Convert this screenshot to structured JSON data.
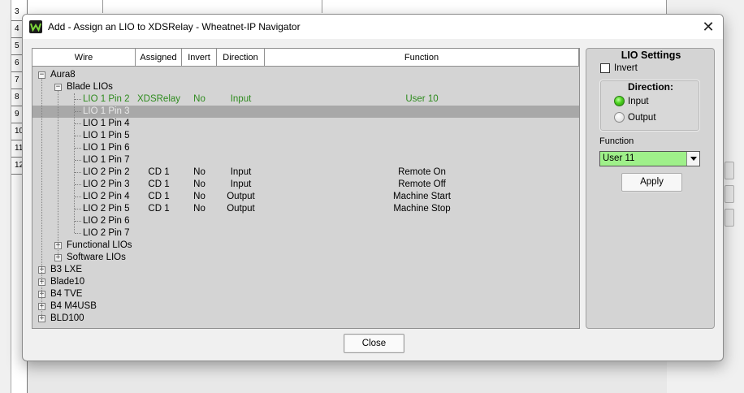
{
  "background": {
    "row_numbers": [
      "3",
      "4",
      "5",
      "6",
      "7",
      "8",
      "9",
      "10",
      "11",
      "12"
    ]
  },
  "dialog": {
    "title": "Add - Assign an LIO to XDSRelay - Wheatnet-IP Navigator",
    "close_icon_glyph": "✕",
    "close_button_label": "Close"
  },
  "tree": {
    "columns": [
      "Wire",
      "Assigned",
      "Invert",
      "Direction",
      "Function"
    ],
    "rows": [
      {
        "level": 0,
        "expander": "−",
        "wire": "Aura8",
        "assigned": "",
        "invert": "",
        "direction": "",
        "function": "",
        "state": "normal"
      },
      {
        "level": 1,
        "expander": "−",
        "wire": "Blade LIOs",
        "assigned": "",
        "invert": "",
        "direction": "",
        "function": "",
        "state": "normal"
      },
      {
        "level": 2,
        "expander": "",
        "wire": "LIO 1 Pin 2",
        "assigned": "XDSRelay",
        "invert": "No",
        "direction": "Input",
        "function": "User 10",
        "state": "green"
      },
      {
        "level": 2,
        "expander": "",
        "wire": "LIO 1 Pin 3",
        "assigned": "",
        "invert": "",
        "direction": "",
        "function": "",
        "state": "selected"
      },
      {
        "level": 2,
        "expander": "",
        "wire": "LIO 1 Pin 4",
        "assigned": "",
        "invert": "",
        "direction": "",
        "function": "",
        "state": "normal"
      },
      {
        "level": 2,
        "expander": "",
        "wire": "LIO 1 Pin 5",
        "assigned": "",
        "invert": "",
        "direction": "",
        "function": "",
        "state": "normal"
      },
      {
        "level": 2,
        "expander": "",
        "wire": "LIO 1 Pin 6",
        "assigned": "",
        "invert": "",
        "direction": "",
        "function": "",
        "state": "normal"
      },
      {
        "level": 2,
        "expander": "",
        "wire": "LIO 1 Pin 7",
        "assigned": "",
        "invert": "",
        "direction": "",
        "function": "",
        "state": "normal"
      },
      {
        "level": 2,
        "expander": "",
        "wire": "LIO 2 Pin 2",
        "assigned": "CD 1",
        "invert": "No",
        "direction": "Input",
        "function": "Remote On",
        "state": "normal"
      },
      {
        "level": 2,
        "expander": "",
        "wire": "LIO 2 Pin 3",
        "assigned": "CD 1",
        "invert": "No",
        "direction": "Input",
        "function": "Remote Off",
        "state": "normal"
      },
      {
        "level": 2,
        "expander": "",
        "wire": "LIO 2 Pin 4",
        "assigned": "CD 1",
        "invert": "No",
        "direction": "Output",
        "function": "Machine Start",
        "state": "normal"
      },
      {
        "level": 2,
        "expander": "",
        "wire": "LIO 2 Pin 5",
        "assigned": "CD 1",
        "invert": "No",
        "direction": "Output",
        "function": "Machine Stop",
        "state": "normal"
      },
      {
        "level": 2,
        "expander": "",
        "wire": "LIO 2 Pin 6",
        "assigned": "",
        "invert": "",
        "direction": "",
        "function": "",
        "state": "normal"
      },
      {
        "level": 2,
        "expander": "",
        "wire": "LIO 2 Pin 7",
        "assigned": "",
        "invert": "",
        "direction": "",
        "function": "",
        "state": "normal"
      },
      {
        "level": 1,
        "expander": "+",
        "wire": "Functional LIOs",
        "assigned": "",
        "invert": "",
        "direction": "",
        "function": "",
        "state": "normal"
      },
      {
        "level": 1,
        "expander": "+",
        "wire": "Software LIOs",
        "assigned": "",
        "invert": "",
        "direction": "",
        "function": "",
        "state": "normal"
      },
      {
        "level": 0,
        "expander": "+",
        "wire": "B3 LXE",
        "assigned": "",
        "invert": "",
        "direction": "",
        "function": "",
        "state": "normal"
      },
      {
        "level": 0,
        "expander": "+",
        "wire": "Blade10",
        "assigned": "",
        "invert": "",
        "direction": "",
        "function": "",
        "state": "normal"
      },
      {
        "level": 0,
        "expander": "+",
        "wire": "B4 TVE",
        "assigned": "",
        "invert": "",
        "direction": "",
        "function": "",
        "state": "normal"
      },
      {
        "level": 0,
        "expander": "+",
        "wire": "B4 M4USB",
        "assigned": "",
        "invert": "",
        "direction": "",
        "function": "",
        "state": "normal"
      },
      {
        "level": 0,
        "expander": "+",
        "wire": "BLD100",
        "assigned": "",
        "invert": "",
        "direction": "",
        "function": "",
        "state": "normal"
      }
    ]
  },
  "settings": {
    "title": "LIO Settings",
    "invert_label": "Invert",
    "invert_checked": false,
    "direction_title": "Direction:",
    "direction_options": [
      "Input",
      "Output"
    ],
    "direction_selected": "Input",
    "function_label": "Function",
    "function_value": "User 11",
    "apply_label": "Apply"
  },
  "colors": {
    "assigned_green": "#2e8b1e",
    "selected_row": "#a8a8a8",
    "function_field": "#9ff08a",
    "panel_bg": "#d4d4d4"
  }
}
